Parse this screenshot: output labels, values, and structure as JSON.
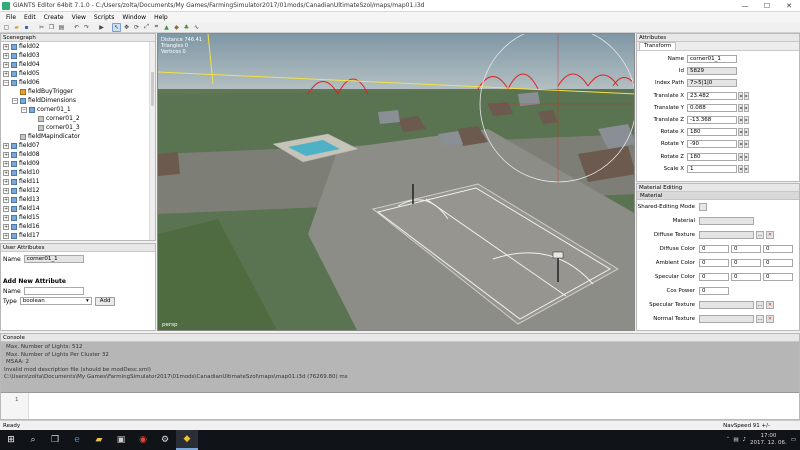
{
  "window": {
    "title": "GIANTS Editor 64bit 7.1.0 - C:/Users/zolta/Documents/My Games/FarmingSimulator2017/01mods/CanadianUltimateSzol/maps/map01.i3d",
    "minimize": "—",
    "maximize": "☐",
    "close": "✕"
  },
  "menu": [
    "File",
    "Edit",
    "Create",
    "View",
    "Scripts",
    "Window",
    "Help"
  ],
  "scenegraph": {
    "title": "Scenegraph",
    "items": [
      {
        "label": "field02",
        "level": 1,
        "type": "group",
        "exp": "+"
      },
      {
        "label": "field03",
        "level": 1,
        "type": "group",
        "exp": "+"
      },
      {
        "label": "field04",
        "level": 1,
        "type": "group",
        "exp": "+"
      },
      {
        "label": "field05",
        "level": 1,
        "type": "group",
        "exp": "+"
      },
      {
        "label": "field06",
        "level": 1,
        "type": "group",
        "exp": "−"
      },
      {
        "label": "fieldBuyTrigger",
        "level": 2,
        "type": "trigger",
        "exp": ""
      },
      {
        "label": "fieldDimensions",
        "level": 2,
        "type": "group",
        "exp": "−"
      },
      {
        "label": "corner01_1",
        "level": 3,
        "type": "group",
        "exp": "−"
      },
      {
        "label": "corner01_2",
        "level": 4,
        "type": "shape",
        "exp": ""
      },
      {
        "label": "corner01_3",
        "level": 4,
        "type": "shape",
        "exp": ""
      },
      {
        "label": "fieldMapIndicator",
        "level": 2,
        "type": "shape",
        "exp": ""
      },
      {
        "label": "field07",
        "level": 1,
        "type": "group",
        "exp": "+"
      },
      {
        "label": "field08",
        "level": 1,
        "type": "group",
        "exp": "+"
      },
      {
        "label": "field09",
        "level": 1,
        "type": "group",
        "exp": "+"
      },
      {
        "label": "field10",
        "level": 1,
        "type": "group",
        "exp": "+"
      },
      {
        "label": "field11",
        "level": 1,
        "type": "group",
        "exp": "+"
      },
      {
        "label": "field12",
        "level": 1,
        "type": "group",
        "exp": "+"
      },
      {
        "label": "field13",
        "level": 1,
        "type": "group",
        "exp": "+"
      },
      {
        "label": "field14",
        "level": 1,
        "type": "group",
        "exp": "+"
      },
      {
        "label": "field15",
        "level": 1,
        "type": "group",
        "exp": "+"
      },
      {
        "label": "field16",
        "level": 1,
        "type": "group",
        "exp": "+"
      },
      {
        "label": "field17",
        "level": 1,
        "type": "group",
        "exp": "+"
      }
    ]
  },
  "user_attributes": {
    "title": "User Attributes",
    "name_label": "Name",
    "name_value": "corner01_1",
    "add_title": "Add New Attribute",
    "new_name_label": "Name",
    "type_label": "Type",
    "type_value": "boolean",
    "add_button": "Add"
  },
  "viewport": {
    "info_lines": [
      "Distance 746.41",
      "Triangles 0",
      "Vertices 0"
    ],
    "camera": "persp"
  },
  "attributes": {
    "title": "Attributes",
    "tab": "Transform",
    "rows": [
      {
        "label": "Name",
        "value": "corner01_1",
        "grey": false,
        "spin": false
      },
      {
        "label": "Id",
        "value": "5829",
        "grey": true,
        "spin": false
      },
      {
        "label": "Index Path",
        "value": "7>5|1|0",
        "grey": true,
        "spin": false
      },
      {
        "label": "Translate X",
        "value": "23.482",
        "grey": false,
        "spin": true
      },
      {
        "label": "Translate Y",
        "value": "0.088",
        "grey": false,
        "spin": true
      },
      {
        "label": "Translate Z",
        "value": "-13.368",
        "grey": false,
        "spin": true
      },
      {
        "label": "Rotate X",
        "value": "180",
        "grey": false,
        "spin": true
      },
      {
        "label": "Rotate Y",
        "value": "-90",
        "grey": false,
        "spin": true
      },
      {
        "label": "Rotate Z",
        "value": "180",
        "grey": false,
        "spin": true
      },
      {
        "label": "Scale X",
        "value": "1",
        "grey": false,
        "spin": true
      }
    ]
  },
  "material": {
    "title": "Material Editing",
    "section": "Material",
    "shared_mode": "Shared-Editing Mode",
    "material_label": "Material",
    "diffuse_texture": "Diffuse Texture",
    "diffuse_color": "Diffuse Color",
    "ambient_color": "Ambient Color",
    "specular_color": "Specular Color",
    "cos_power": "Cos Power",
    "specular_texture": "Specular Texture",
    "normal_texture": "Normal Texture",
    "zero": "0"
  },
  "console": {
    "title": "Console",
    "lines": [
      "Max. Number of Lights: 512",
      "Max. Number of Lights Per Cluster 32",
      "MSAA: 2",
      "Invalid mod description file (should be modDesc.xml)",
      "C:\\Users\\zolta\\Documents\\My Games\\FarmingSimulator2017\\01mods\\CanadianUltimateSzol\\maps\\map01.i3d (76269.80) ms"
    ],
    "line_number": "1"
  },
  "status": {
    "left": "Ready",
    "right": "NavSpeed 91 +/-"
  },
  "taskbar": {
    "time": "17:00",
    "date": "2017. 12. 06."
  },
  "colors": {
    "sky": "#a9b7bd",
    "grass": "#55704a",
    "road": "#8e8f89",
    "accent": "#3a7bd5",
    "gizmo_red": "#e02020"
  }
}
